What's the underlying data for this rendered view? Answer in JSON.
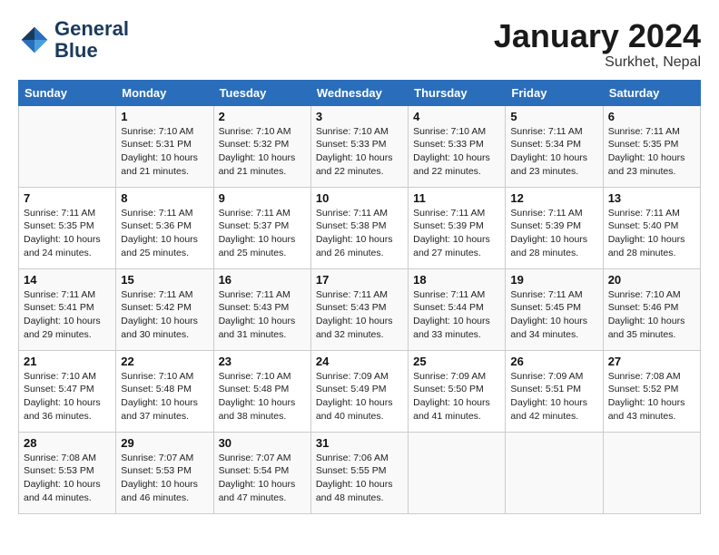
{
  "header": {
    "logo_line1": "General",
    "logo_line2": "Blue",
    "month": "January 2024",
    "location": "Surkhet, Nepal"
  },
  "weekdays": [
    "Sunday",
    "Monday",
    "Tuesday",
    "Wednesday",
    "Thursday",
    "Friday",
    "Saturday"
  ],
  "weeks": [
    [
      {
        "day": "",
        "info": ""
      },
      {
        "day": "1",
        "info": "Sunrise: 7:10 AM\nSunset: 5:31 PM\nDaylight: 10 hours\nand 21 minutes."
      },
      {
        "day": "2",
        "info": "Sunrise: 7:10 AM\nSunset: 5:32 PM\nDaylight: 10 hours\nand 21 minutes."
      },
      {
        "day": "3",
        "info": "Sunrise: 7:10 AM\nSunset: 5:33 PM\nDaylight: 10 hours\nand 22 minutes."
      },
      {
        "day": "4",
        "info": "Sunrise: 7:10 AM\nSunset: 5:33 PM\nDaylight: 10 hours\nand 22 minutes."
      },
      {
        "day": "5",
        "info": "Sunrise: 7:11 AM\nSunset: 5:34 PM\nDaylight: 10 hours\nand 23 minutes."
      },
      {
        "day": "6",
        "info": "Sunrise: 7:11 AM\nSunset: 5:35 PM\nDaylight: 10 hours\nand 23 minutes."
      }
    ],
    [
      {
        "day": "7",
        "info": "Sunrise: 7:11 AM\nSunset: 5:35 PM\nDaylight: 10 hours\nand 24 minutes."
      },
      {
        "day": "8",
        "info": "Sunrise: 7:11 AM\nSunset: 5:36 PM\nDaylight: 10 hours\nand 25 minutes."
      },
      {
        "day": "9",
        "info": "Sunrise: 7:11 AM\nSunset: 5:37 PM\nDaylight: 10 hours\nand 25 minutes."
      },
      {
        "day": "10",
        "info": "Sunrise: 7:11 AM\nSunset: 5:38 PM\nDaylight: 10 hours\nand 26 minutes."
      },
      {
        "day": "11",
        "info": "Sunrise: 7:11 AM\nSunset: 5:39 PM\nDaylight: 10 hours\nand 27 minutes."
      },
      {
        "day": "12",
        "info": "Sunrise: 7:11 AM\nSunset: 5:39 PM\nDaylight: 10 hours\nand 28 minutes."
      },
      {
        "day": "13",
        "info": "Sunrise: 7:11 AM\nSunset: 5:40 PM\nDaylight: 10 hours\nand 28 minutes."
      }
    ],
    [
      {
        "day": "14",
        "info": "Sunrise: 7:11 AM\nSunset: 5:41 PM\nDaylight: 10 hours\nand 29 minutes."
      },
      {
        "day": "15",
        "info": "Sunrise: 7:11 AM\nSunset: 5:42 PM\nDaylight: 10 hours\nand 30 minutes."
      },
      {
        "day": "16",
        "info": "Sunrise: 7:11 AM\nSunset: 5:43 PM\nDaylight: 10 hours\nand 31 minutes."
      },
      {
        "day": "17",
        "info": "Sunrise: 7:11 AM\nSunset: 5:43 PM\nDaylight: 10 hours\nand 32 minutes."
      },
      {
        "day": "18",
        "info": "Sunrise: 7:11 AM\nSunset: 5:44 PM\nDaylight: 10 hours\nand 33 minutes."
      },
      {
        "day": "19",
        "info": "Sunrise: 7:11 AM\nSunset: 5:45 PM\nDaylight: 10 hours\nand 34 minutes."
      },
      {
        "day": "20",
        "info": "Sunrise: 7:10 AM\nSunset: 5:46 PM\nDaylight: 10 hours\nand 35 minutes."
      }
    ],
    [
      {
        "day": "21",
        "info": "Sunrise: 7:10 AM\nSunset: 5:47 PM\nDaylight: 10 hours\nand 36 minutes."
      },
      {
        "day": "22",
        "info": "Sunrise: 7:10 AM\nSunset: 5:48 PM\nDaylight: 10 hours\nand 37 minutes."
      },
      {
        "day": "23",
        "info": "Sunrise: 7:10 AM\nSunset: 5:48 PM\nDaylight: 10 hours\nand 38 minutes."
      },
      {
        "day": "24",
        "info": "Sunrise: 7:09 AM\nSunset: 5:49 PM\nDaylight: 10 hours\nand 40 minutes."
      },
      {
        "day": "25",
        "info": "Sunrise: 7:09 AM\nSunset: 5:50 PM\nDaylight: 10 hours\nand 41 minutes."
      },
      {
        "day": "26",
        "info": "Sunrise: 7:09 AM\nSunset: 5:51 PM\nDaylight: 10 hours\nand 42 minutes."
      },
      {
        "day": "27",
        "info": "Sunrise: 7:08 AM\nSunset: 5:52 PM\nDaylight: 10 hours\nand 43 minutes."
      }
    ],
    [
      {
        "day": "28",
        "info": "Sunrise: 7:08 AM\nSunset: 5:53 PM\nDaylight: 10 hours\nand 44 minutes."
      },
      {
        "day": "29",
        "info": "Sunrise: 7:07 AM\nSunset: 5:53 PM\nDaylight: 10 hours\nand 46 minutes."
      },
      {
        "day": "30",
        "info": "Sunrise: 7:07 AM\nSunset: 5:54 PM\nDaylight: 10 hours\nand 47 minutes."
      },
      {
        "day": "31",
        "info": "Sunrise: 7:06 AM\nSunset: 5:55 PM\nDaylight: 10 hours\nand 48 minutes."
      },
      {
        "day": "",
        "info": ""
      },
      {
        "day": "",
        "info": ""
      },
      {
        "day": "",
        "info": ""
      }
    ]
  ]
}
